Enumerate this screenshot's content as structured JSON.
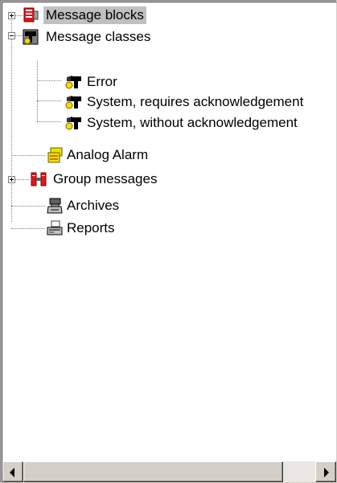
{
  "tree": {
    "nodes": [
      {
        "label": "Message blocks",
        "icon": "message-blocks-icon",
        "expander": "plus",
        "selected": true
      },
      {
        "label": "Message classes",
        "icon": "message-classes-icon",
        "expander": "minus"
      },
      {
        "label": "Error",
        "icon": "message-class-icon"
      },
      {
        "label": "System, requires acknowledgement",
        "icon": "message-class-icon"
      },
      {
        "label": "System, without acknowledgement",
        "icon": "message-class-icon"
      },
      {
        "label": "Analog Alarm",
        "icon": "analog-alarm-icon"
      },
      {
        "label": "Group messages",
        "icon": "group-messages-icon",
        "expander": "plus"
      },
      {
        "label": "Archives",
        "icon": "archives-icon"
      },
      {
        "label": "Reports",
        "icon": "reports-icon"
      }
    ]
  },
  "scrollbar": {
    "left_arrow": "scroll-left-icon",
    "right_arrow": "scroll-right-icon",
    "thumb_fraction": 0.89
  }
}
